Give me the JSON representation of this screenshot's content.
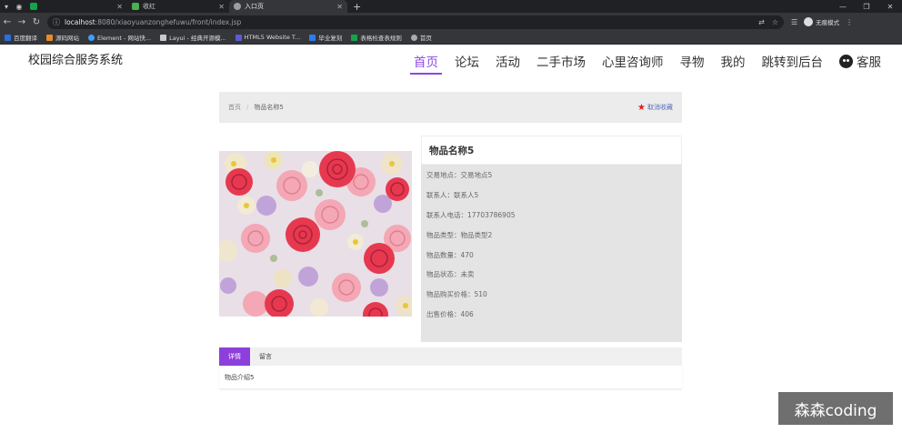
{
  "browser": {
    "tabs": [
      {
        "label": "",
        "color": "#16a34a"
      },
      {
        "label": "收红",
        "color": "#4caf50"
      },
      {
        "label": "入口页",
        "color": "#9e9e9e",
        "active": true
      }
    ],
    "url_host": "localhost",
    "url_path": ":8080/xiaoyuanzonghefuwu/front/index.jsp",
    "profile_label": "无痕模式",
    "bookmarks": [
      {
        "label": "百度翻译",
        "color": "#2a6edc"
      },
      {
        "label": "源码网站",
        "color": "#e88b2b"
      },
      {
        "label": "Element - 网站快...",
        "color": "#409eff"
      },
      {
        "label": "Layui - 经典开源模...",
        "color": "#c9c9c9"
      },
      {
        "label": "HTML5 Website T...",
        "color": "#5b5bd6"
      },
      {
        "label": "毕业复刻",
        "color": "#2b7de9"
      },
      {
        "label": "表格检查表规则",
        "color": "#16a34a"
      },
      {
        "label": "首页",
        "color": "#aaaaaa"
      }
    ]
  },
  "site": {
    "title": "校园综合服务系统",
    "nav": [
      "首页",
      "论坛",
      "活动",
      "二手市场",
      "心里咨询师",
      "寻物",
      "我的",
      "跳转到后台"
    ],
    "nav_active": "首页",
    "kefu": "客服",
    "accent": "#8d46e8"
  },
  "breadcrumb": {
    "home": "首页",
    "separator": "/",
    "current": "物品名称5"
  },
  "favorite": {
    "label": "取消收藏"
  },
  "item": {
    "name": "物品名称5",
    "fields": [
      {
        "label": "交易地点：",
        "value": "交易地点5"
      },
      {
        "label": "联系人：",
        "value": "联系人5"
      },
      {
        "label": "联系人电话：",
        "value": "17703786905"
      },
      {
        "label": "物品类型：",
        "value": "物品类型2"
      },
      {
        "label": "物品数量：",
        "value": "470"
      },
      {
        "label": "物品状态：",
        "value": "未卖"
      },
      {
        "label": "物品购买价格：",
        "value": "510"
      },
      {
        "label": "出售价格：",
        "value": "406"
      }
    ]
  },
  "detail_tabs": [
    "详情",
    "留言"
  ],
  "detail_content": "物品介绍5",
  "watermark": "森森coding"
}
